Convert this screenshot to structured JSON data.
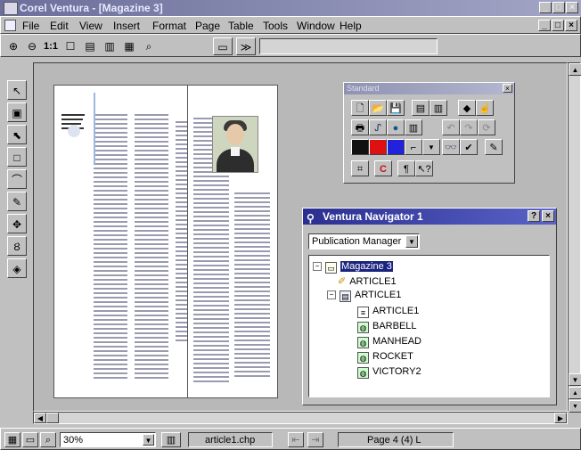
{
  "window": {
    "title": "Corel Ventura - [Magazine 3]"
  },
  "menu": [
    {
      "label": "File"
    },
    {
      "label": "Edit"
    },
    {
      "label": "View"
    },
    {
      "label": "Insert"
    },
    {
      "label": "Format"
    },
    {
      "label": "Page"
    },
    {
      "label": "Table"
    },
    {
      "label": "Tools"
    },
    {
      "label": "Window"
    },
    {
      "label": "Help"
    }
  ],
  "toolbar": {
    "zoom_one_label": "1:1"
  },
  "standard_toolbar": {
    "title": "Standard"
  },
  "navigator": {
    "title": "Ventura Navigator 1",
    "dropdown_value": "Publication Manager",
    "tree": [
      {
        "label": "Magazine 3",
        "selected": true
      },
      {
        "label": "ARTICLE1"
      },
      {
        "label": "ARTICLE1"
      },
      {
        "label": "ARTICLE1"
      },
      {
        "label": "BARBELL"
      },
      {
        "label": "MANHEAD"
      },
      {
        "label": "ROCKET"
      },
      {
        "label": "VICTORY2"
      }
    ]
  },
  "statusbar": {
    "zoom": "30%",
    "filename": "article1.chp",
    "page_info": "Page 4 (4)  L"
  }
}
